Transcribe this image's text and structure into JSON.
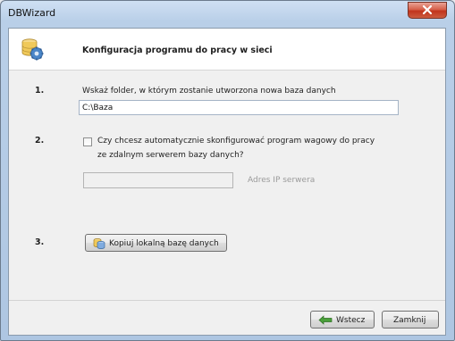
{
  "window": {
    "title": "DBWizard",
    "close_glyph": "X"
  },
  "header": {
    "icon": "database-settings-icon",
    "title": "Konfiguracja programu do pracy w sieci"
  },
  "step1": {
    "number": "1.",
    "label": "Wskaż folder, w którym zostanie utworzona nowa baza danych",
    "path_value": "C:\\Baza",
    "browse_icon": "folder-open-icon"
  },
  "step2": {
    "number": "2.",
    "checkbox_checked": false,
    "label_line1": "Czy chcesz automatycznie skonfigurować program wagowy do pracy",
    "label_line2": "ze zdalnym serwerem bazy danych?",
    "ip_value": "",
    "ip_label": "Adres IP serwera"
  },
  "step3": {
    "number": "3.",
    "button_label": "Kopiuj lokalną bazę danych",
    "button_icon": "database-copy-icon"
  },
  "footer": {
    "back_label": "Wstecz",
    "back_icon": "arrow-left-icon",
    "close_label": "Zamknij"
  },
  "colors": {
    "title_bar": "#b9cfe8",
    "close_button": "#c1341c",
    "dialog_bg": "#f0f0f0",
    "header_bg": "#ffffff"
  }
}
